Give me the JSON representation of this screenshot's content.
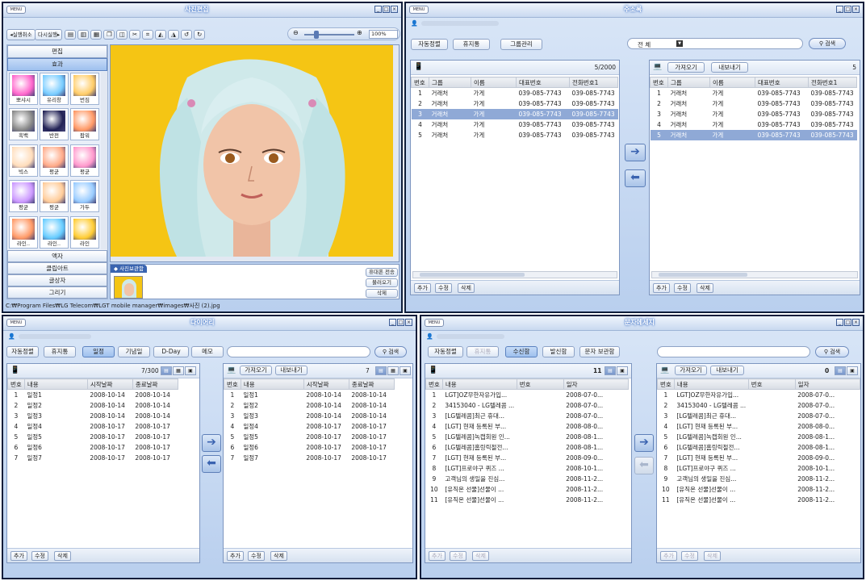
{
  "photo": {
    "title": "사진편집",
    "menu": "MENU",
    "undo": "◂실행취소",
    "redo": "다시실행▸",
    "zoom": "100%",
    "side": {
      "edit": "편집",
      "effect": "효과",
      "frame": "액자",
      "clipart": "클립아트",
      "text": "글상자",
      "draw": "그리기"
    },
    "effects": [
      "뽀샤시",
      "유리창",
      "번짐",
      "흑백",
      "반전",
      "팝워",
      "빅스",
      "평균",
      "평균",
      "평균",
      "평균",
      "가두",
      "라인..",
      "라인..",
      "라인"
    ],
    "tray_label": "◆ 사진보관함",
    "btn_send": "휴대폰 전송",
    "btn_load": "불러오기",
    "btn_delete": "삭제",
    "status": "C:₩Program Files₩LG Telecom₩LGT mobile manager₩images₩사진 (2).jpg"
  },
  "address": {
    "title": "주소록",
    "menu": "MENU",
    "btn_auto": "자동정렬",
    "btn_trash": "휴지통",
    "btn_group": "그룹관리",
    "filter": "전 체",
    "search": "검색",
    "left_count": "5/2000",
    "right_count": "5",
    "btn_import": "가져오기",
    "btn_export": "내보내기",
    "headers": [
      "번호",
      "그룹",
      "이름",
      "대표번호",
      "전화번호1"
    ],
    "rows": [
      [
        "1",
        "거래처",
        "가게",
        "039-085-7743",
        "039-085-7743"
      ],
      [
        "2",
        "거래처",
        "가게",
        "039-085-7743",
        "039-085-7743"
      ],
      [
        "3",
        "거래처",
        "가게",
        "039-085-7743",
        "039-085-7743"
      ],
      [
        "4",
        "거래처",
        "가게",
        "039-085-7743",
        "039-085-7743"
      ],
      [
        "5",
        "거래처",
        "가게",
        "039-085-7743",
        "039-085-7743"
      ]
    ],
    "add": "추가",
    "edit": "수정",
    "del": "삭제"
  },
  "diary": {
    "title": "다이어리",
    "menu": "MENU",
    "btn_auto": "자동정렬",
    "btn_trash": "휴지통",
    "tabs": [
      "일정",
      "기념일",
      "D-Day",
      "메모"
    ],
    "search": "검색",
    "left_count": "7/300",
    "right_count": "7",
    "btn_import": "가져오기",
    "btn_export": "내보내기",
    "headers": [
      "번호",
      "내용",
      "시작날짜",
      "종료날짜"
    ],
    "rows": [
      [
        "1",
        "일정1",
        "2008-10-14",
        "2008-10-14"
      ],
      [
        "2",
        "일정2",
        "2008-10-14",
        "2008-10-14"
      ],
      [
        "3",
        "일정3",
        "2008-10-14",
        "2008-10-14"
      ],
      [
        "4",
        "일정4",
        "2008-10-17",
        "2008-10-17"
      ],
      [
        "5",
        "일정5",
        "2008-10-17",
        "2008-10-17"
      ],
      [
        "6",
        "일정6",
        "2008-10-17",
        "2008-10-17"
      ],
      [
        "7",
        "일정7",
        "2008-10-17",
        "2008-10-17"
      ]
    ],
    "add": "추가",
    "edit": "수정",
    "del": "삭제"
  },
  "sms": {
    "title": "문자메세지",
    "menu": "MENU",
    "btn_auto": "자동정렬",
    "btn_trash": "휴지통",
    "tabs": [
      "수신함",
      "발신함",
      "문자 보관함"
    ],
    "search": "검색",
    "left_count": "11",
    "right_count": "0",
    "btn_import": "가져오기",
    "btn_export": "내보내기",
    "headers": [
      "번호",
      "내용",
      "번호",
      "일자"
    ],
    "rows": [
      [
        "1",
        "LGT]OZ무한자유가입...",
        "",
        "2008-07-0..."
      ],
      [
        "2",
        "34153040 - LG텔레콤 ...",
        "",
        "2008-07-0..."
      ],
      [
        "3",
        "[LG텔레콤]최근 휴대...",
        "",
        "2008-07-0..."
      ],
      [
        "4",
        "[LGT] 현재 등록된 부...",
        "",
        "2008-08-0..."
      ],
      [
        "5",
        "[LG텔레콤]녹캡회원 인...",
        "",
        "2008-08-1..."
      ],
      [
        "6",
        "[LG텔레콤]홈링릭절전...",
        "",
        "2008-08-1..."
      ],
      [
        "7",
        "[LGT] 현재 등록된 부...",
        "",
        "2008-09-0..."
      ],
      [
        "8",
        "[LGT]프로야구 퀴즈 ...",
        "",
        "2008-10-1..."
      ],
      [
        "9",
        "고객님의 생일을 진심...",
        "",
        "2008-11-2..."
      ],
      [
        "10",
        "[유직온 선물]선물이 ...",
        "",
        "2008-11-2..."
      ],
      [
        "11",
        "[유직온 선물]선물이 ...",
        "",
        "2008-11-2..."
      ]
    ],
    "add": "추가",
    "edit": "수정",
    "del": "삭제"
  }
}
